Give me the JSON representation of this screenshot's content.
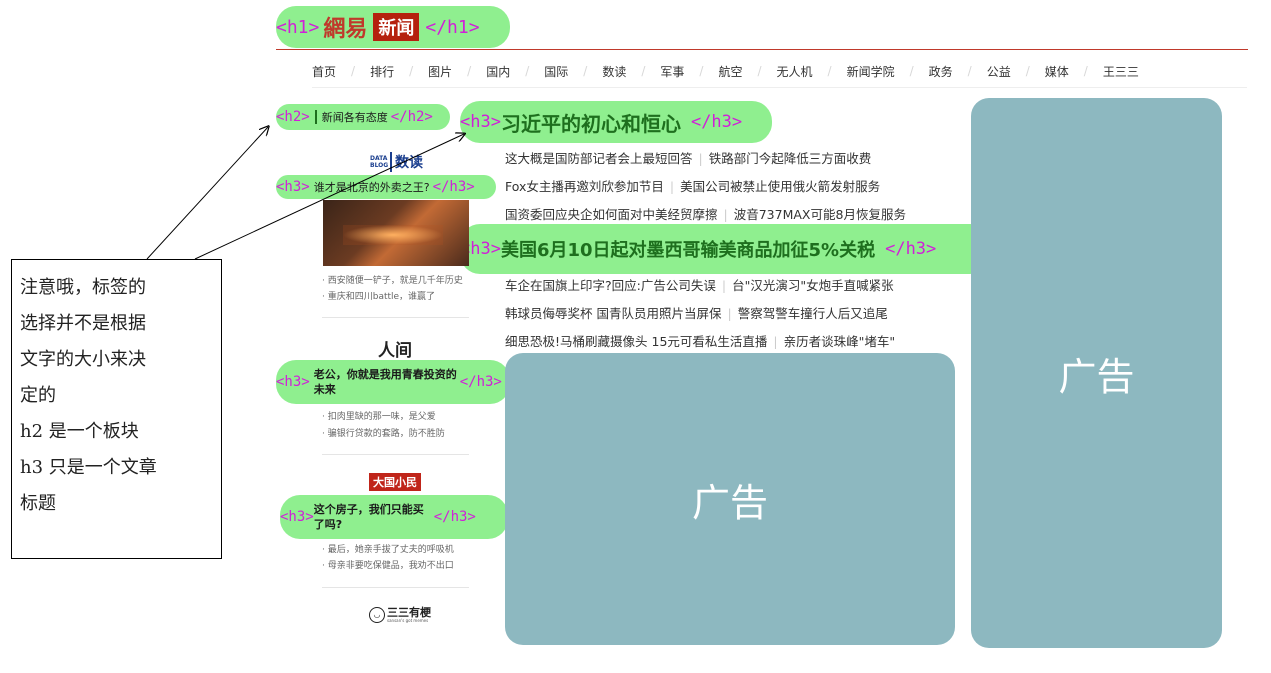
{
  "h1": {
    "open_tag": "<h1>",
    "close_tag": "</h1>",
    "logo_wangyi": "網易",
    "logo_news": "新闻"
  },
  "nav": {
    "items": [
      "首页",
      "排行",
      "图片",
      "国内",
      "国际",
      "数读",
      "军事",
      "航空",
      "无人机",
      "新闻学院",
      "政务",
      "公益",
      "媒体",
      "王三三"
    ]
  },
  "h2_pill": {
    "open_tag": "<h2>",
    "close_tag": "</h2>",
    "text": "新闻各有态度"
  },
  "main_headline": {
    "open_tag": "<h3>",
    "close_tag": "</h3>",
    "text": "习近平的初心和恒心"
  },
  "news_group1": [
    [
      "这大概是国防部记者会上最短回答",
      "铁路部门今起降低三方面收费"
    ],
    [
      "Fox女主播再邀刘欣参加节目",
      "美国公司被禁止使用俄火箭发射服务"
    ],
    [
      "国资委回应央企如何面对中美经贸摩擦",
      "波音737MAX可能8月恢复服务"
    ]
  ],
  "second_headline": {
    "open_tag": "<h3>",
    "close_tag": "</h3>",
    "text": "美国6月10日起对墨西哥输美商品加征5%关税"
  },
  "news_group2": [
    [
      "车企在国旗上印字?回应:广告公司失误",
      "台\"汉光演习\"女炮手直喊紧张"
    ],
    [
      "韩球员侮辱奖杯 国青队员用照片当屏保",
      "警察驾警车撞行人后又追尾"
    ],
    [
      "细思恐极!马桶刷藏摄像头 15元可看私生活直播",
      "亲历者谈珠峰\"堵车\""
    ]
  ],
  "sidebar": {
    "section1_logo": "数读",
    "section1_logo_small": "DATA BLOG",
    "section1_title": "谁才是北京的外卖之王?",
    "section1_bullets": [
      "西安随便一铲子，就是几千年历史",
      "重庆和四川battle，谁赢了"
    ],
    "section2_logo": "人间",
    "section2_title": "老公，你就是我用青春投资的未来",
    "section2_bullets": [
      "扣肉里缺的那一味，是父爱",
      "骗银行贷款的套路，防不胜防"
    ],
    "section3_logo": "大国小民",
    "section3_title": "这个房子，我们只能买了吗?",
    "section3_bullets": [
      "最后，她亲手拔了丈夫的呼吸机",
      "母亲非要吃保健品，我劝不出口"
    ],
    "section4_logo": "三三有梗",
    "section4_logo_small": "sansan's got memes",
    "h3_open": "<h3>",
    "h3_close": "</h3>"
  },
  "ads": {
    "label": "广告"
  },
  "note": {
    "lines": [
      "注意哦，标签的",
      "选择并不是根据",
      "文字的大小来决",
      "定的",
      "h2 是一个板块",
      "h3 只是一个文章",
      "标题"
    ]
  },
  "colors": {
    "pill_green": "#8fef8f",
    "tag_magenta": "#d020d8",
    "ad_bg": "#8db8c0",
    "brand_red": "#b5210e"
  }
}
